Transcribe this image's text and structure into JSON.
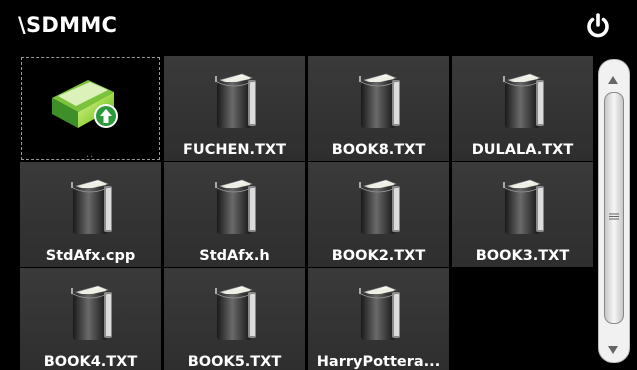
{
  "header": {
    "path": "\\SDMMC",
    "power_icon": "power-icon"
  },
  "grid": {
    "up_folder": {
      "icon": "folder-up-icon",
      "label": "..",
      "accent": "#2a9a3a"
    },
    "files": [
      {
        "label": "FUCHEN.TXT",
        "icon": "book-file-icon"
      },
      {
        "label": "BOOK8.TXT",
        "icon": "book-file-icon"
      },
      {
        "label": "DULALA.TXT",
        "icon": "book-file-icon"
      },
      {
        "label": "StdAfx.cpp",
        "icon": "book-file-icon"
      },
      {
        "label": "StdAfx.h",
        "icon": "book-file-icon"
      },
      {
        "label": "BOOK2.TXT",
        "icon": "book-file-icon"
      },
      {
        "label": "BOOK3.TXT",
        "icon": "book-file-icon"
      },
      {
        "label": "BOOK4.TXT",
        "icon": "book-file-icon"
      },
      {
        "label": "BOOK5.TXT",
        "icon": "book-file-icon"
      },
      {
        "label": "HarryPottera...",
        "icon": "book-file-icon"
      }
    ]
  },
  "scrollbar": {
    "up_icon": "scroll-up-arrow-icon",
    "down_icon": "scroll-down-arrow-icon",
    "grip_icon": "scroll-grip-icon"
  }
}
